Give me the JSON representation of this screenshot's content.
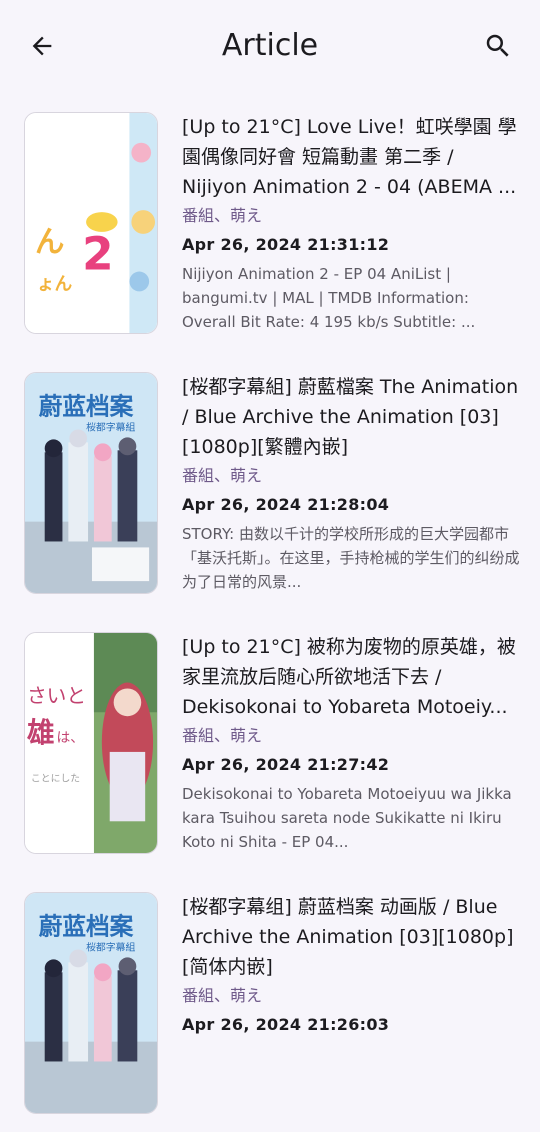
{
  "header": {
    "title": "Article",
    "back_icon": "arrow-back-icon",
    "search_icon": "search-icon"
  },
  "articles": [
    {
      "title": "[Up to 21°C] Love Live！虹咲學園 學園偶像同好會 短篇動畫 第二季 / Nijiyon Animation 2 - 04 (ABEMA ...",
      "tags": "番組、萌え",
      "date": "Apr 26, 2024 21:31:12",
      "description": "Nijiyon Animation 2 - EP 04 AniList | bangumi.tv | MAL | TMDB Information: Overall Bit Rate: 4 195 kb/s Subtitle: ..."
    },
    {
      "title": "[桜都字幕組] 蔚藍檔案 The Animation / Blue Archive the Animation [03][1080p][繁體內嵌]",
      "tags": "番組、萌え",
      "date": "Apr 26, 2024 21:28:04",
      "description": "STORY: 由数以千计的学校所形成的巨大学园都市「基沃托斯」。在这里，手持枪械的学生们的纠纷成为了日常的风景..."
    },
    {
      "title": "[Up to 21°C] 被称为废物的原英雄，被家里流放后随心所欲地活下去 / Dekisokonai to Yobareta Motoeiy...",
      "tags": "番組、萌え",
      "date": "Apr 26, 2024 21:27:42",
      "description": "Dekisokonai to Yobareta Motoeiyuu wa Jikka kara Tsuihou sareta node Sukikatte ni Ikiru Koto ni Shita - EP 04..."
    },
    {
      "title": "[桜都字幕组] 蔚蓝档案 动画版 / Blue Archive the Animation [03][1080p][简体内嵌]",
      "tags": "番組、萌え",
      "date": "Apr 26, 2024 21:26:03",
      "description": ""
    }
  ]
}
